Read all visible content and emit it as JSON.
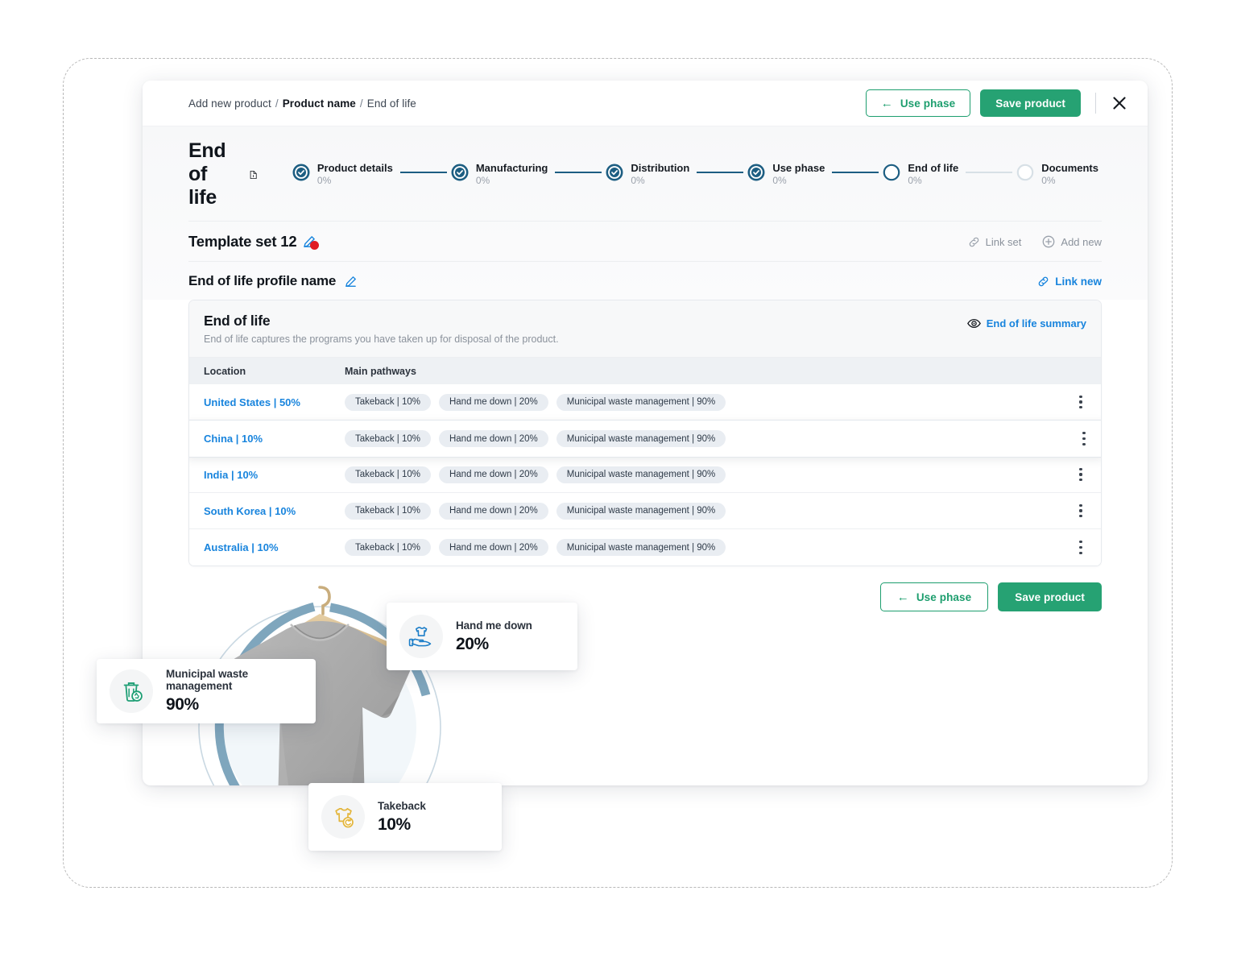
{
  "frame": {
    "note": "dashed-outline-canvas"
  },
  "topbar": {
    "breadcrumb": [
      {
        "label": "Add new product",
        "bold": false
      },
      {
        "label": "Product name",
        "bold": true
      },
      {
        "label": "End of life",
        "bold": false
      }
    ],
    "separator": "/",
    "use_phase_label": "Use phase",
    "save_product_label": "Save product",
    "close_icon": "close-icon"
  },
  "phase": {
    "title": "End of life",
    "title_icon": "document-icon"
  },
  "stepper": {
    "steps": [
      {
        "name": "Product details",
        "pct": "0%",
        "state": "complete"
      },
      {
        "name": "Manufacturing",
        "pct": "0%",
        "state": "complete"
      },
      {
        "name": "Distribution",
        "pct": "0%",
        "state": "complete"
      },
      {
        "name": "Use phase",
        "pct": "0%",
        "state": "complete"
      },
      {
        "name": "End of life",
        "pct": "0%",
        "state": "current"
      },
      {
        "name": "Documents",
        "pct": "0%",
        "state": "upcoming"
      }
    ]
  },
  "template_set": {
    "title": "Template set 12",
    "edit_icon": "pencil-icon",
    "link_set_label": "Link set",
    "add_new_label": "Add new"
  },
  "profile": {
    "title": "End of life profile name",
    "edit_icon": "pencil-icon",
    "link_new_label": "Link new"
  },
  "eol_card": {
    "title": "End of life",
    "subtitle": "End of life captures the programs you have taken up for disposal of the product.",
    "summary_label": "End of life summary",
    "summary_icon": "eye-icon",
    "columns": [
      "Location",
      "Main pathways"
    ],
    "rows": [
      {
        "location": "United States",
        "location_pct": "50%",
        "active": false,
        "pathways": [
          "Takeback | 10%",
          "Hand me down | 20%",
          "Municipal waste management | 90%"
        ]
      },
      {
        "location": "China",
        "location_pct": "10%",
        "active": true,
        "pathways": [
          "Takeback | 10%",
          "Hand me down | 20%",
          "Municipal waste management | 90%"
        ]
      },
      {
        "location": "India",
        "location_pct": "10%",
        "active": false,
        "pathways": [
          "Takeback | 10%",
          "Hand me down | 20%",
          "Municipal waste management | 90%"
        ]
      },
      {
        "location": "South Korea",
        "location_pct": "10%",
        "active": false,
        "pathways": [
          "Takeback | 10%",
          "Hand me down | 20%",
          "Municipal waste management | 90%"
        ]
      },
      {
        "location": "Australia",
        "location_pct": "10%",
        "active": false,
        "pathways": [
          "Takeback | 10%",
          "Hand me down | 20%",
          "Municipal waste management | 90%"
        ]
      }
    ]
  },
  "footer": {
    "use_phase_label": "Use phase",
    "save_product_label": "Save product"
  },
  "stat_cards": [
    {
      "key": "mwm",
      "label": "Municipal waste management",
      "value": "90%",
      "icon": "trash-recycle-icon",
      "color": "#1d9e74"
    },
    {
      "key": "hmd",
      "label": "Hand me down",
      "value": "20%",
      "icon": "hand-shirt-icon",
      "color": "#1d7ec8"
    },
    {
      "key": "tb",
      "label": "Takeback",
      "value": "10%",
      "icon": "shirt-return-icon",
      "color": "#e3b53b"
    }
  ],
  "product_visual": {
    "alt": "grey t-shirt on wooden hanger",
    "ring_color": "#7fa6bd",
    "accent_color": "#bdd4e2"
  },
  "colors": {
    "green": "#26a273",
    "blue": "#1884dd",
    "navy": "#1d5e82",
    "muted": "#8b929c"
  }
}
